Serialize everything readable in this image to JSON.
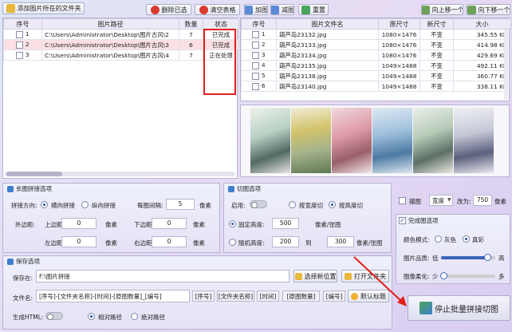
{
  "toolbar": {
    "add_folder": "添加图片所在的文件夹",
    "delete_selected": "删除已选",
    "clear_table": "清空表格",
    "add_image": "加图",
    "remove_image": "减图",
    "reset": "重置",
    "move_up": "向上移一个",
    "move_down": "向下移一个"
  },
  "folder_table": {
    "headers": [
      "序号",
      "图片路径",
      "数量",
      "状态"
    ],
    "rows": [
      {
        "index": "1",
        "path": "C:\\Users\\Administrator\\Desktop\\图片古风\\2",
        "count": "7",
        "status": "已完成"
      },
      {
        "index": "2",
        "path": "C:\\Users\\Administrator\\Desktop\\图片古风\\3",
        "count": "6",
        "status": "已完成"
      },
      {
        "index": "3",
        "path": "C:\\Users\\Administrator\\Desktop\\图片古风\\4",
        "count": "7",
        "status": "正在处理"
      }
    ]
  },
  "file_table": {
    "headers": [
      "序号",
      "图片文件名",
      "原尺寸",
      "新尺寸",
      "大小"
    ],
    "rows": [
      {
        "index": "1",
        "name": "葫芦岛23132.jpg",
        "orig": "1080×1476",
        "new": "不变",
        "size": "345.55 KB"
      },
      {
        "index": "2",
        "name": "葫芦岛23133.jpg",
        "orig": "1080×1476",
        "new": "不变",
        "size": "414.98 KB"
      },
      {
        "index": "3",
        "name": "葫芦岛23134.jpg",
        "orig": "1080×1476",
        "new": "不变",
        "size": "429.69 KB"
      },
      {
        "index": "4",
        "name": "葫芦岛23135.jpg",
        "orig": "1049×1488",
        "new": "不变",
        "size": "492.11 KB"
      },
      {
        "index": "5",
        "name": "葫芦岛23138.jpg",
        "orig": "1049×1488",
        "new": "不变",
        "size": "360.77 KB"
      },
      {
        "index": "6",
        "name": "葫芦岛23140.jpg",
        "orig": "1049×1488",
        "new": "不变",
        "size": "338.11 KB"
      }
    ]
  },
  "long_image": {
    "title": "长图拼接选项",
    "direction_label": "拼接方向:",
    "horizontal": "横向拼接",
    "vertical": "纵向拼接",
    "per_row_label": "每图间隔:",
    "per_row_value": "5",
    "per_row_unit": "像素",
    "margin_label": "外边距:",
    "top_label": "上边距:",
    "top_value": "0",
    "top_unit": "像素",
    "bottom_label": "下边距:",
    "bottom_value": "0",
    "bottom_unit": "像素",
    "left_label": "左边距:",
    "left_value": "0",
    "left_unit": "像素",
    "right_label": "右边距:",
    "right_value": "0",
    "right_unit": "像素"
  },
  "cut_image": {
    "title": "切图选项",
    "enable_label": "启用:",
    "by_width": "按宽度切",
    "by_height": "按高度切",
    "fixed_label": "固定高度:",
    "fixed_value": "500",
    "fixed_unit": "像素/张图",
    "random_label": "随机高度:",
    "random_from": "200",
    "random_to_label": "到",
    "random_to": "300",
    "random_unit": "像素/张图"
  },
  "border": {
    "label": "描图",
    "mode": "宽度",
    "change_label": "改为:",
    "value": "750",
    "unit": "像素"
  },
  "complete_image": {
    "title": "完成图选项",
    "color_mode_label": "颜色模式:",
    "gray": "灰色",
    "true_color": "真彩",
    "quality_label": "图片品质:",
    "quality_low": "低",
    "quality_high": "高",
    "quality_level": 0.85,
    "soft_label": "图像柔化:",
    "soft_low": "少",
    "soft_high": "多",
    "soft_level": 0.05
  },
  "save": {
    "title": "保存选项",
    "location_label": "保存在:",
    "location_value": "F:\\图片拼接",
    "choose_btn": "选择新位置",
    "open_btn": "打开文件夹",
    "filename_label": "文件名:",
    "filename_value": "[序号]-[文件夹名称]-[时间]-[原图数量]_[编号]",
    "tags": [
      "[序号]",
      "[文件夹名称]",
      "[时间]",
      "[原图数量]",
      "[编号]"
    ],
    "default_btn": "默认标题",
    "html_label": "生成HTML:",
    "relative": "相对路径",
    "absolute": "绝对路径"
  },
  "action": {
    "stop_label": "停止批量拼接切图"
  },
  "colors": {
    "accent": "#2a4fae",
    "status_box": "#e0201a",
    "arrow": "#e0201a"
  }
}
